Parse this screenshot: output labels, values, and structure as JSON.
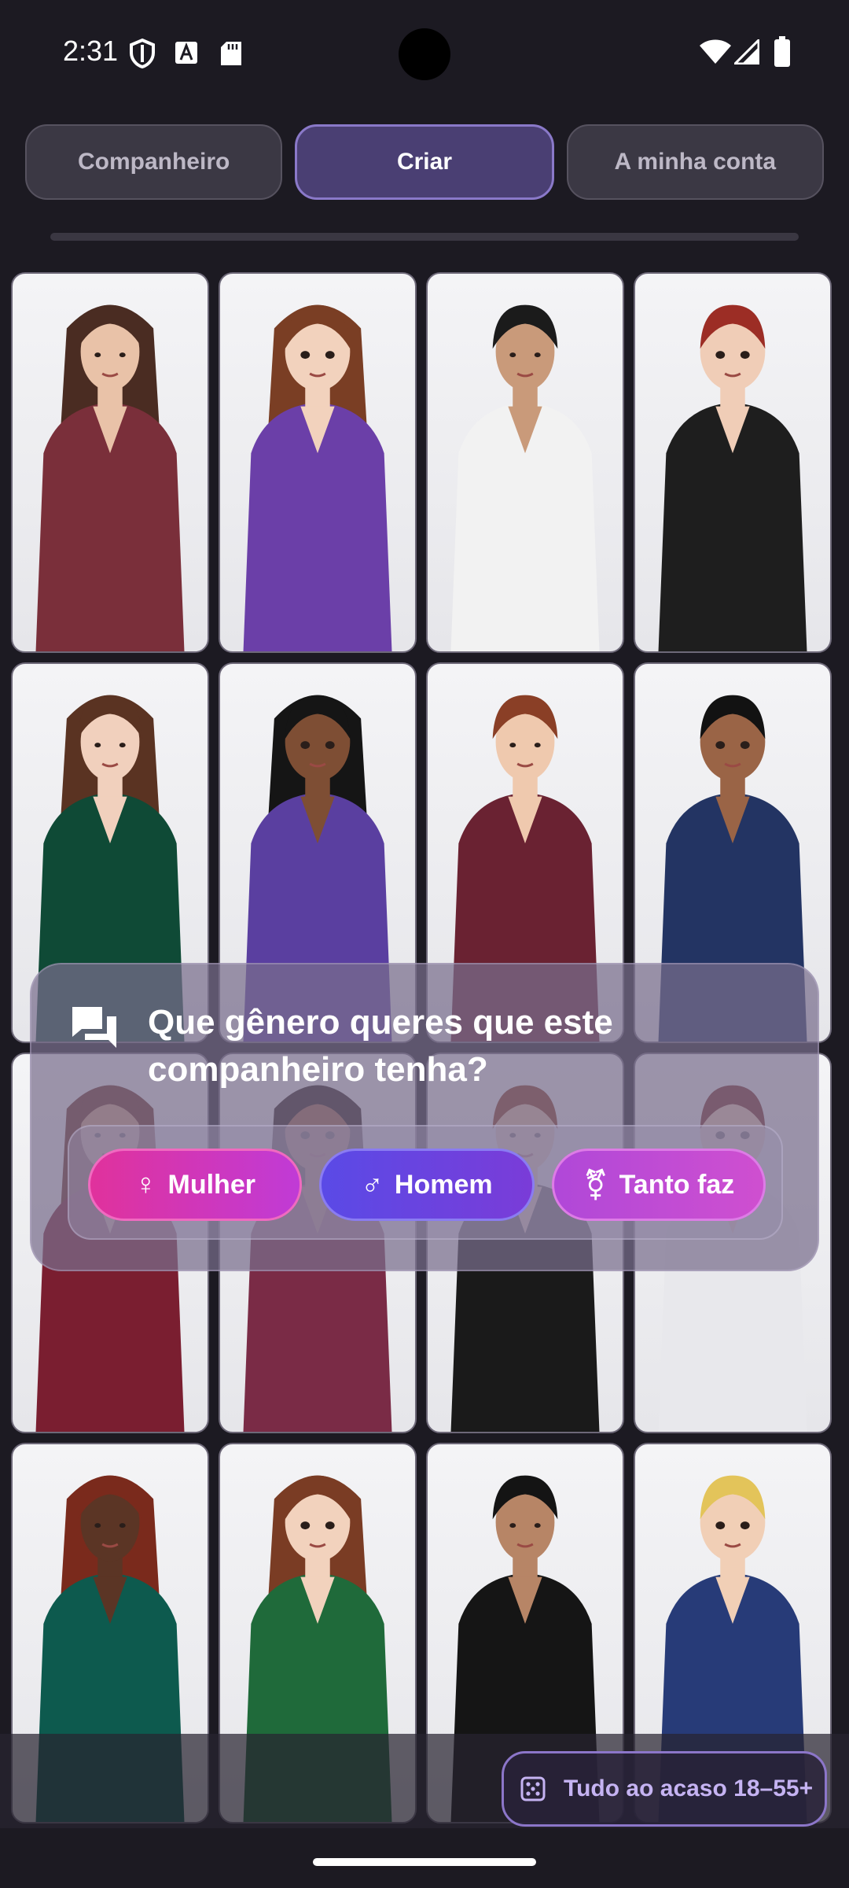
{
  "status_bar": {
    "time": "2:31",
    "icons": [
      "shield-icon",
      "font-icon",
      "sd-card-icon",
      "wifi-icon",
      "signal-icon",
      "battery-icon"
    ]
  },
  "tabs": [
    {
      "label": "Companheiro",
      "active": false
    },
    {
      "label": "Criar",
      "active": true
    },
    {
      "label": "A minha conta",
      "active": false
    }
  ],
  "grid": {
    "cards": [
      {
        "style": "photo",
        "outfit": "#7a2f3a",
        "hair": "#4a2c22",
        "skin": "#e9c2a8"
      },
      {
        "style": "anime",
        "outfit": "#6b3fa8",
        "hair": "#7a3e24",
        "skin": "#f2d2bd"
      },
      {
        "style": "photo",
        "outfit": "#f2f2f2",
        "hair": "#1b1b1b",
        "skin": "#c99a7a"
      },
      {
        "style": "anime",
        "outfit": "#1e1e1e",
        "hair": "#9c2d25",
        "skin": "#f0cdb7"
      },
      {
        "style": "photo",
        "outfit": "#0f4a36",
        "hair": "#5a3322",
        "skin": "#f1d0bd"
      },
      {
        "style": "anime",
        "outfit": "#5a3fa0",
        "hair": "#151515",
        "skin": "#7e4e34"
      },
      {
        "style": "photo",
        "outfit": "#6a2232",
        "hair": "#8a3f26",
        "skin": "#efc9ae"
      },
      {
        "style": "anime",
        "outfit": "#233463",
        "hair": "#121212",
        "skin": "#9a6446"
      },
      {
        "style": "photo",
        "outfit": "#7a1e30",
        "hair": "#6b2f20",
        "skin": "#d8a487"
      },
      {
        "style": "anime",
        "outfit": "#7a2b46",
        "hair": "#2a1a16",
        "skin": "#a06a4e"
      },
      {
        "style": "photo",
        "outfit": "#1a1a1a",
        "hair": "#8a3a1e",
        "skin": "#e7c1a4"
      },
      {
        "style": "anime",
        "outfit": "#e8e8ec",
        "hair": "#7a2e26",
        "skin": "#efcbb3"
      },
      {
        "style": "photo",
        "outfit": "#0d5a4e",
        "hair": "#7a2a1c",
        "skin": "#5b3525"
      },
      {
        "style": "anime",
        "outfit": "#1f6a3a",
        "hair": "#7a3c24",
        "skin": "#f2d2bd"
      },
      {
        "style": "photo",
        "outfit": "#151515",
        "hair": "#141414",
        "skin": "#b78566"
      },
      {
        "style": "anime",
        "outfit": "#273b78",
        "hair": "#e3c45a",
        "skin": "#f1cfb6"
      }
    ]
  },
  "dialog": {
    "question": "Que gênero queres que este companheiro tenha?",
    "icon": "chat-bubbles-icon",
    "options": {
      "female": {
        "label": "Mulher",
        "icon": "female-icon",
        "glyph": "♀"
      },
      "male": {
        "label": "Homem",
        "icon": "male-icon",
        "glyph": "♂"
      },
      "any": {
        "label": "Tanto faz",
        "icon": "transgender-icon",
        "glyph": "⚧"
      }
    }
  },
  "random_button": {
    "label": "Tudo ao acaso 18–55+",
    "icon": "dice-icon"
  }
}
